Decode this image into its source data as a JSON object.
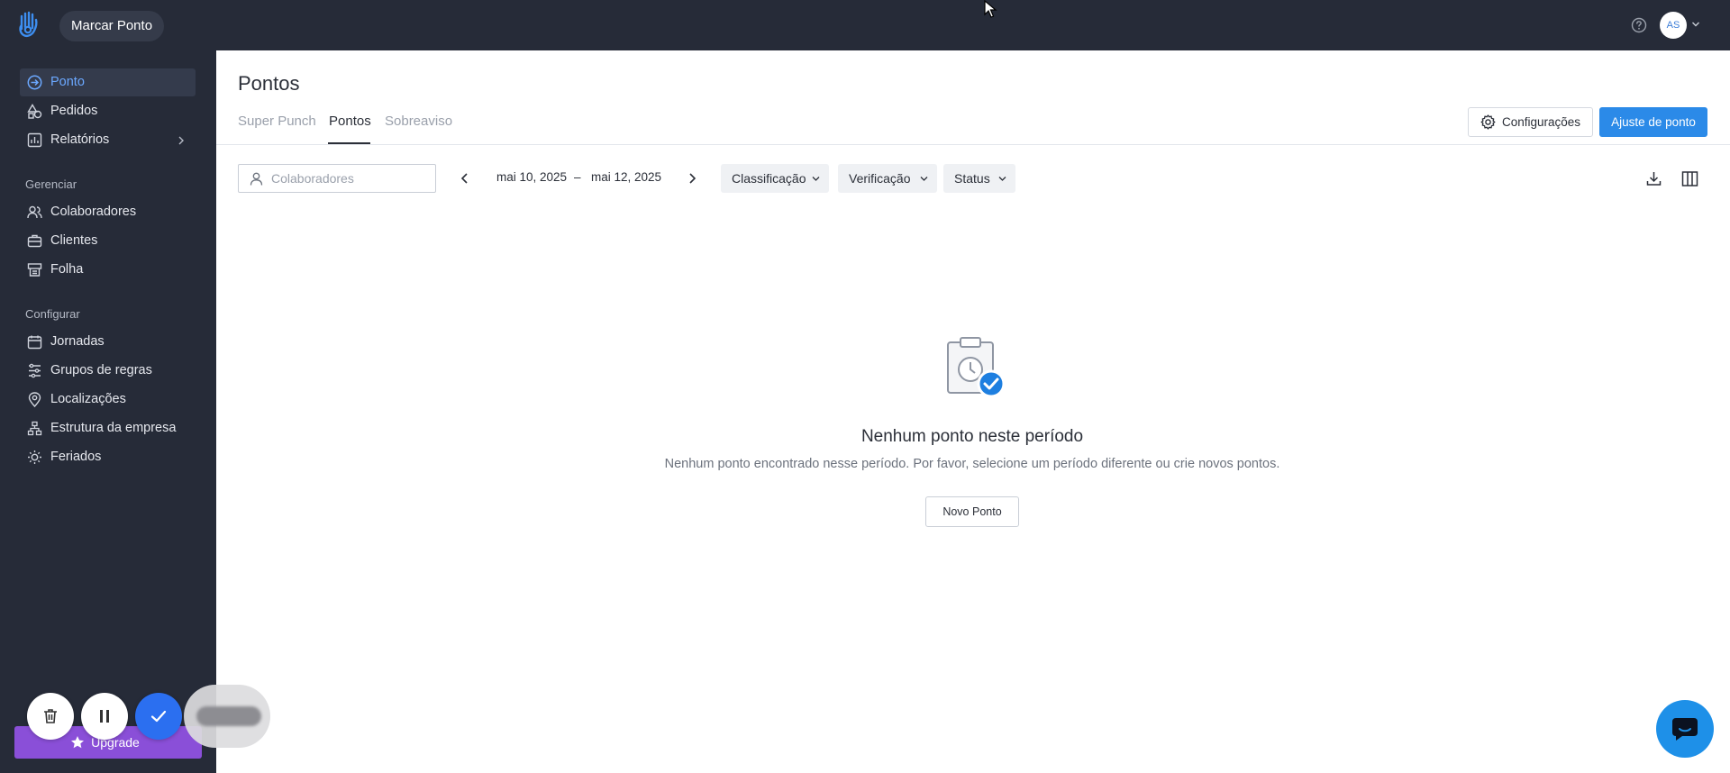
{
  "topbar": {
    "action_label": "Marcar Ponto",
    "avatar_initials": "AS"
  },
  "sidebar": {
    "items": [
      {
        "label": "Ponto",
        "icon": "arrow-circle-icon"
      },
      {
        "label": "Pedidos",
        "icon": "shapes-icon"
      },
      {
        "label": "Relatórios",
        "icon": "chart-icon"
      }
    ],
    "manage_section": "Gerenciar",
    "manage_items": [
      {
        "label": "Colaboradores",
        "icon": "users-icon"
      },
      {
        "label": "Clientes",
        "icon": "briefcase-icon"
      },
      {
        "label": "Folha",
        "icon": "payroll-icon"
      }
    ],
    "config_section": "Configurar",
    "config_items": [
      {
        "label": "Jornadas",
        "icon": "calendar-icon"
      },
      {
        "label": "Grupos de regras",
        "icon": "rules-icon"
      },
      {
        "label": "Localizações",
        "icon": "pin-icon"
      },
      {
        "label": "Estrutura da empresa",
        "icon": "org-icon"
      },
      {
        "label": "Feriados",
        "icon": "sun-icon"
      }
    ],
    "upgrade_label": "Upgrade"
  },
  "main": {
    "title": "Pontos",
    "tabs": [
      {
        "label": "Super Punch",
        "active": false
      },
      {
        "label": "Pontos",
        "active": true
      },
      {
        "label": "Sobreaviso",
        "active": false
      }
    ],
    "config_button": "Configurações",
    "primary_button": "Ajuste de ponto",
    "search_placeholder": "Colaboradores",
    "date_start": "mai 10, 2025",
    "date_separator": "–",
    "date_end": "mai 12, 2025",
    "filters": [
      "Classificação",
      "Verificação",
      "Status"
    ]
  },
  "empty_state": {
    "title": "Nenhum ponto neste período",
    "description": "Nenhum ponto encontrado nesse período. Por favor, selecione um período diferente ou crie novos pontos.",
    "button": "Novo Ponto"
  },
  "recording": {
    "timer": "00:00:00"
  },
  "colors": {
    "sidebar_bg": "#262b38",
    "accent": "#2b8ae8",
    "active_nav_text": "#6ba8ff",
    "upgrade": "#8a4fd8"
  }
}
